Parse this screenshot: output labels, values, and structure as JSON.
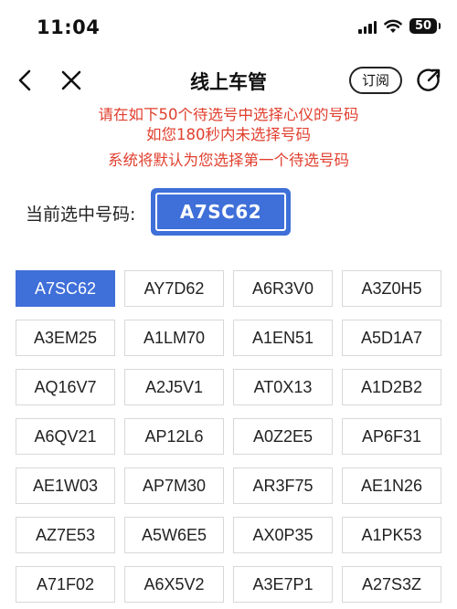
{
  "status": {
    "time": "11:04",
    "battery": "50"
  },
  "nav": {
    "title": "线上车管",
    "subscribe_label": "订阅",
    "icons": [
      "chevron-left-icon",
      "close-icon",
      "share-icon"
    ]
  },
  "notice": {
    "line1": "请在如下50个待选号中选择心仪的号码",
    "line2": "如您180秒内未选择号码",
    "line3": "系统将默认为您选择第一个待选号码",
    "color": "#e0402f"
  },
  "current": {
    "label": "当前选中号码:",
    "value": "A7SC62"
  },
  "theme": {
    "accent": "#3f6fd8"
  },
  "plates": [
    "A7SC62",
    "AY7D62",
    "A6R3V0",
    "A3Z0H5",
    "A3EM25",
    "A1LM70",
    "A1EN51",
    "A5D1A7",
    "AQ16V7",
    "A2J5V1",
    "AT0X13",
    "A1D2B2",
    "A6QV21",
    "AP12L6",
    "A0Z2E5",
    "AP6F31",
    "AE1W03",
    "AP7M30",
    "AR3F75",
    "AE1N26",
    "AZ7E53",
    "A5W6E5",
    "AX0P35",
    "A1PK53",
    "A71F02",
    "A6X5V2",
    "A3E7P1",
    "A27S3Z"
  ],
  "selected_index": 0
}
